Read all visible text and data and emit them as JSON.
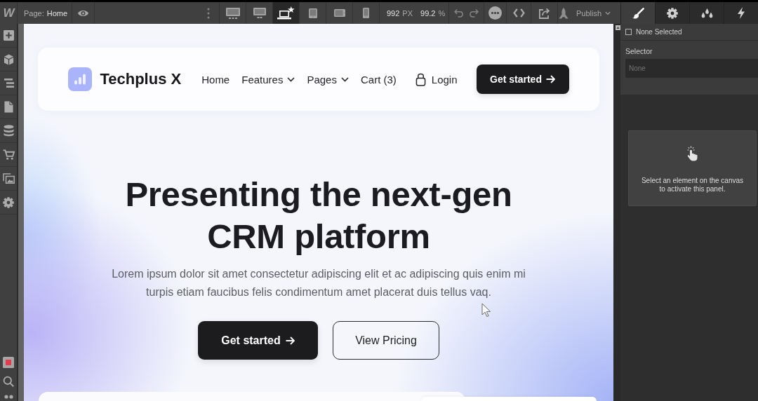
{
  "toolbar": {
    "logo": "W",
    "page_label": "Page:",
    "page_name": "Home",
    "devices": [
      {
        "kind": "large-desktop",
        "selected": false
      },
      {
        "kind": "desktop",
        "selected": false
      },
      {
        "kind": "laptop",
        "selected": true
      },
      {
        "kind": "tablet",
        "selected": false
      },
      {
        "kind": "landscape",
        "selected": false
      },
      {
        "kind": "phone",
        "selected": false
      }
    ],
    "width_value": "992",
    "width_unit": "PX",
    "zoom_value": "99.2",
    "zoom_unit": "%",
    "publish": "Publish"
  },
  "canvas": {
    "navbar": {
      "brand": "Techplus X",
      "links": [
        {
          "label": "Home",
          "dropdown": false
        },
        {
          "label": "Features",
          "dropdown": true
        },
        {
          "label": "Pages",
          "dropdown": true
        },
        {
          "label": "Cart (3)",
          "dropdown": false
        }
      ],
      "login": "Login",
      "cta": "Get started"
    },
    "hero": {
      "title": "Presenting the next-gen CRM platform",
      "description": "Lorem ipsum dolor sit amet consectetur adipiscing elit et ac adipiscing quis enim mi turpis etiam faucibus felis condimentum amet placerat duis tellus vaq.",
      "buttons": [
        {
          "label": "Get started",
          "kind": "primary"
        },
        {
          "label": "View Pricing",
          "kind": "outline"
        }
      ]
    }
  },
  "panel": {
    "tabs": [
      {
        "kind": "brush",
        "selected": true
      },
      {
        "kind": "gear",
        "selected": false
      },
      {
        "kind": "drops",
        "selected": false
      },
      {
        "kind": "bolt",
        "selected": false
      }
    ],
    "selection": {
      "label": "None Selected",
      "checked": false
    },
    "selector": {
      "label": "Selector",
      "placeholder": "None"
    },
    "empty_message": "Select an element on the canvas to activate this panel."
  }
}
